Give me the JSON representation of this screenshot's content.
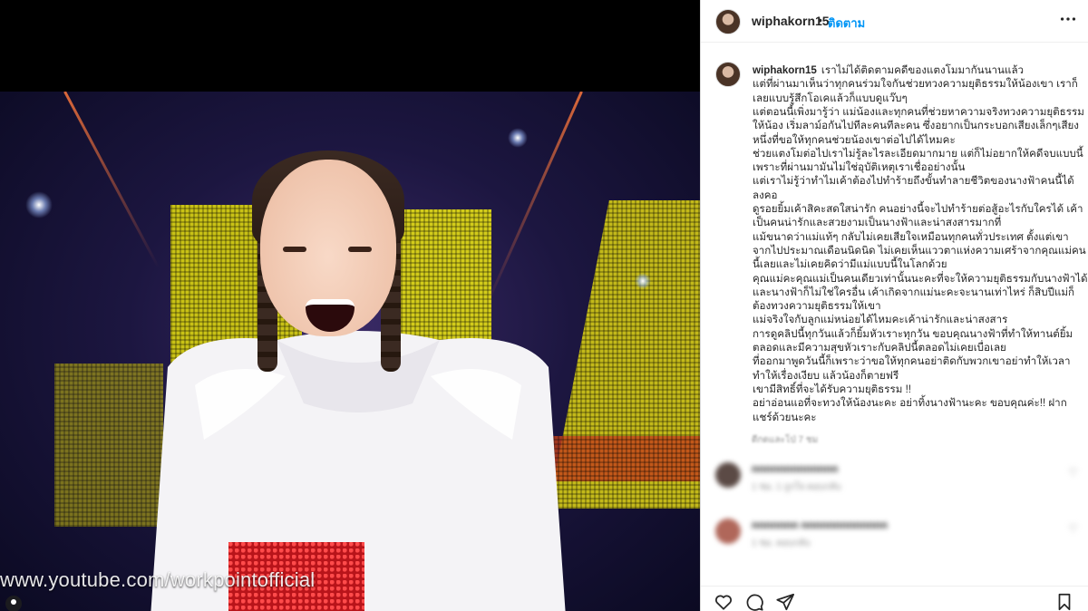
{
  "post": {
    "media": {
      "watermark": "www.youtube.com/workpointofficial"
    }
  },
  "header": {
    "username": "wiphakorn15",
    "separator": "•",
    "follow_label": "ติดตาม",
    "more_icon": "more-horizontal-icon"
  },
  "caption": {
    "username": "wiphakorn15",
    "lines": [
      "เราไม่ได้ติดตามคดีของแตงโมมากันนานแล้ว",
      "แต่ที่ผ่านมาเห็นว่าทุกคนร่วมใจกันช่วยทวงความยุติธรรมให้น้องเขา เราก็",
      "เลยแบบรู้สึกโอเคแล้วก็แบบดูแว๊บๆ",
      "แต่ตอนนี้เพิ่งมารู้ว่า แม่น้องและทุกคนที่ช่วยหาความจริงทวงความยุติธรรม",
      "ให้น้อง เริ่มลาม์อกันไปทีละคนทีละคน ซึ่งอยากเป็นกระบอกเสียงเล็กๆเสียง",
      "หนึ่งที่ขอให้ทุกคนช่วยน้องเขาต่อไปได้ไหมคะ",
      "ช่วยแตงโมต่อไปเราไม่รู้ละไรละเอียดมากมาย แต่ก็ไม่อยากให้คดีจบแบบนี้",
      "เพราะที่ผ่านมามันไม่ใช่อุบัติเหตุเราเชื่ออย่างนั้น",
      "แต่เราไม่รู้ว่าทำไมเค้าต้องไปทำร้ายถึงขั้นทำลายชีวิตของนางฟ้าคนนี้ได้",
      "ลงคอ",
      "ดูรอยยิ้มเค้าสิคะสดใสน่ารัก คนอย่างนี้จะไปทำร้ายต่อสู้อะไรกับใครได้ เค้า",
      "เป็นคนน่ารักและสวยงามเป็นนางฟ้าและน่าสงสารมากที่",
      "แม้ขนาดว่าแม่แท้ๆ กลับไม่เคยเสียใจเหมือนทุกคนทั่วประเทศ ตั้งแต่เขา",
      "จากไปประมาณเดือนนิดนิด ไม่เคยเห็นแววตาแห่งความเศร้าจากคุณแม่คน",
      "นี้เลยและไม่เคยคิดว่ามีแม่แบบนี้ในโลกด้วย",
      "คุณแม่คะคุณแม่เป็นคนเดียวเท่านั้นนะคะที่จะให้ความยุติธรรมกับนางฟ้าได้",
      "และนางฟ้าก็ไม่ใช่ใครอื่น เค้าเกิดจากแม่นะคะจะนานเท่าไหร่ ก็สิบปีแม่ก็",
      "ต้องทวงความยุติธรรมให้เขา",
      "แม่จริงใจกับลูกแม่หน่อยได้ไหมคะเค้าน่ารักและน่าสงสาร",
      "การดูคลิปนี้ทุกวันแล้วก็ยิ้มหัวเราะทุกวัน ขอบคุณนางฟ้าที่ทำให้ทานต์ยิ้ม",
      "ตลอดและมีความสุขหัวเราะกับคลิปนี้ตลอดไม่เคยเบื่อเลย",
      "ที่ออกมาพูดวันนี้ก็เพราะว่าขอให้ทุกคนอย่าติดกับพวกเขาอย่าทำให้เวลา",
      "ทำให้เรื่องเงียบ แล้วน้องก็ตายฟรี",
      "เขามีสิทธิ์ที่จะได้รับความยุติธรรม !!",
      "อย่าอ่อนแอที่จะทวงให้น้องนะคะ อย่าทิ้งนางฟ้านะคะ ขอบคุณค่ะ!! ฝาก",
      "แชร์ด้วยนะคะ"
    ],
    "timestamp": "ดีกดและโป่ 7 ชม"
  },
  "comments": [
    {
      "name": "nnnnnnnnnnnnn",
      "meta": "1 ชม. 1 ถูกใจ ตอบกลับ",
      "avatar_color": "#5b4a45"
    },
    {
      "name": "nnnnnnn nnnnnnnnnnnnn",
      "meta": "1 ชม. ตอบกลับ",
      "avatar_color": "#b0675a"
    }
  ],
  "actions": {
    "like_icon": "heart-icon",
    "comment_icon": "comment-icon",
    "share_icon": "send-icon",
    "save_icon": "bookmark-icon"
  },
  "colors": {
    "follow_blue": "#0095f6",
    "text_primary": "#262626",
    "text_secondary": "#8e8e8e"
  }
}
